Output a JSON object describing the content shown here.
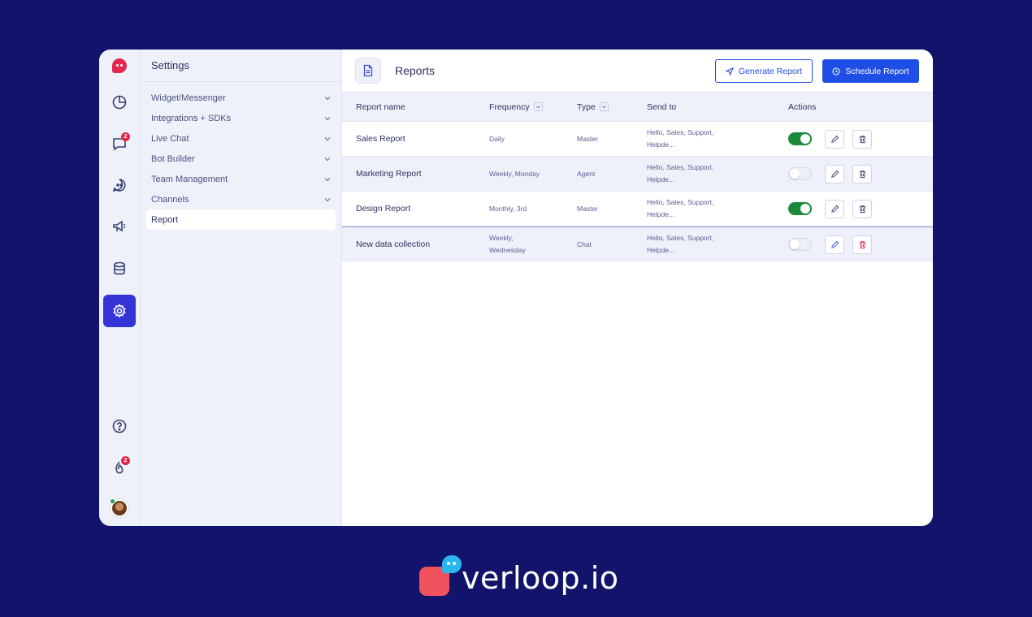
{
  "settings": {
    "title": "Settings",
    "items": [
      {
        "label": "Widget/Messenger"
      },
      {
        "label": "Integrations + SDKs"
      },
      {
        "label": "Live Chat"
      },
      {
        "label": "Bot Builder"
      },
      {
        "label": "Team Management"
      },
      {
        "label": "Channels"
      },
      {
        "label": "Report"
      }
    ]
  },
  "rail": {
    "chat_badge": "2",
    "notification_badge": "2"
  },
  "header": {
    "title": "Reports",
    "generate_label": "Generate Report",
    "schedule_label": "Schedule Report"
  },
  "table": {
    "columns": {
      "name": "Report name",
      "frequency": "Frequency",
      "type": "Type",
      "send_to": "Send to",
      "actions": "Actions"
    },
    "rows": [
      {
        "name": "Sales Report",
        "freq1": "Daily",
        "freq2": "",
        "type": "Master",
        "send1": "Hello, Sales, Support,",
        "send2": "Helpde...",
        "enabled": true
      },
      {
        "name": "Marketing Report",
        "freq1": "Weekly, Monday",
        "freq2": "",
        "type": "Agent",
        "send1": "Hello, Sales, Support,",
        "send2": "Helpde...",
        "enabled": false
      },
      {
        "name": "Design Report",
        "freq1": "Monthly, 3rd",
        "freq2": "",
        "type": "Master",
        "send1": "Hello, Sales, Support,",
        "send2": "Helpde...",
        "enabled": true
      },
      {
        "name": "New data collection",
        "freq1": "Weekly,",
        "freq2": "Wednesday",
        "type": "Chat",
        "send1": "Hello, Sales, Support,",
        "send2": "Helpde...",
        "enabled": false
      }
    ]
  },
  "brand": {
    "text": "verloop.io"
  },
  "colors": {
    "background": "#11146a",
    "accent": "#1f4ee6",
    "toggle_on": "#1a8a3a",
    "badge": "#e5254b",
    "delete_active": "#e5254b"
  }
}
